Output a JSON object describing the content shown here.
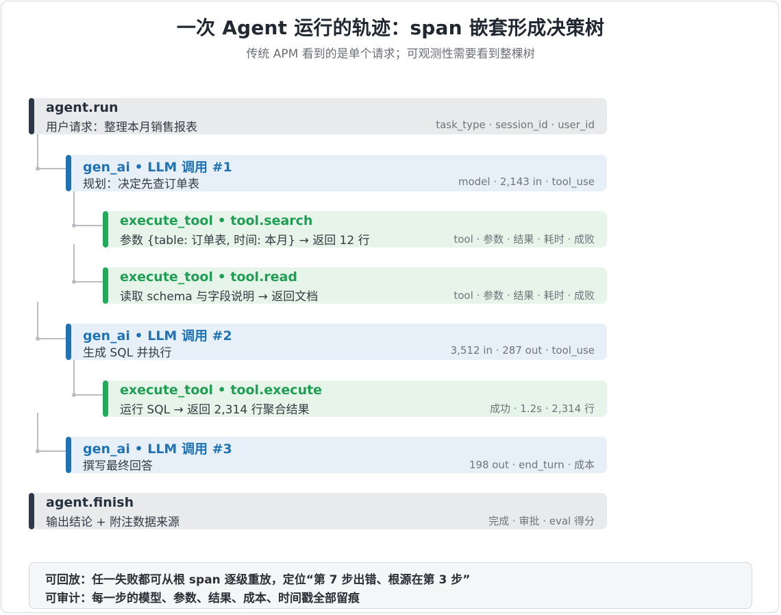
{
  "header": {
    "title": "一次 Agent 运行的轨迹：span 嵌套形成决策树",
    "subtitle": "传统 APM 看到的是单个请求；可观测性需要看到整棵树"
  },
  "spans": [
    {
      "kind": "agent",
      "name": "agent.run",
      "desc": "用户请求：整理本月销售报表",
      "meta": "task_type · session_id · user_id"
    },
    {
      "kind": "llm",
      "name": "gen_ai • LLM 调用 #1",
      "desc": "规划：决定先查订单表",
      "meta": "model · 2,143 in · tool_use"
    },
    {
      "kind": "tool",
      "name": "execute_tool • tool.search",
      "desc": "参数 {table: 订单表, 时间: 本月} → 返回 12 行",
      "meta": "tool · 参数 · 结果 · 耗时 · 成败"
    },
    {
      "kind": "tool",
      "name": "execute_tool • tool.read",
      "desc": "读取 schema 与字段说明 → 返回文档",
      "meta": "tool · 参数 · 结果 · 耗时 · 成败"
    },
    {
      "kind": "llm",
      "name": "gen_ai • LLM 调用 #2",
      "desc": "生成 SQL 并执行",
      "meta": "3,512 in · 287 out · tool_use"
    },
    {
      "kind": "tool",
      "name": "execute_tool • tool.execute",
      "desc": "运行 SQL → 返回 2,314 行聚合结果",
      "meta": "成功 · 1.2s · 2,314 行"
    },
    {
      "kind": "llm",
      "name": "gen_ai • LLM 调用 #3",
      "desc": "撰写最终回答",
      "meta": "198 out · end_turn · 成本"
    },
    {
      "kind": "agent",
      "name": "agent.finish",
      "desc": "输出结论 + 附注数据来源",
      "meta": "完成 · 审批 · eval 得分"
    }
  ],
  "footer": {
    "line1": "可回放：任一失败都可从根 span 逐级重放，定位“第 7 步出错、根源在第 3 步”",
    "line2": "可审计：每一步的模型、参数、结果、成本、时间戳全部留痕"
  },
  "colors": {
    "agent_bar": "#2b3848",
    "llm_accent": "#1f73b4",
    "tool_accent": "#22a95a",
    "connector": "#b9bcc0"
  }
}
